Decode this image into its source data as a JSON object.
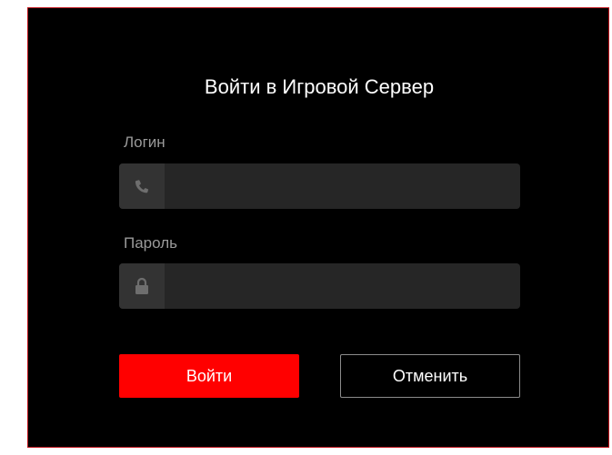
{
  "dialog": {
    "title": "Войти в Игровой Сервер",
    "border_color": "#c0141c",
    "background": "#000000"
  },
  "login": {
    "label": "Логин",
    "icon": "phone-icon",
    "value": "",
    "placeholder": ""
  },
  "password": {
    "label": "Пароль",
    "icon": "lock-icon",
    "value": "",
    "placeholder": ""
  },
  "buttons": {
    "submit_label": "Войти",
    "cancel_label": "Отменить",
    "submit_color": "#ff0000"
  }
}
